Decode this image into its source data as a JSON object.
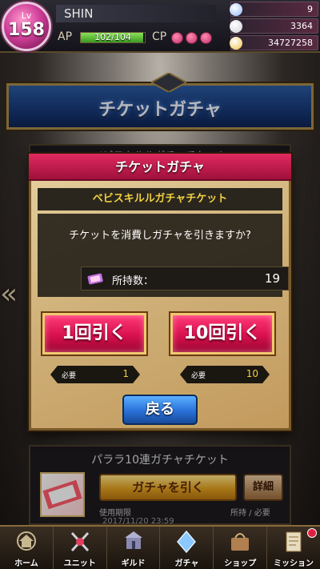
{
  "player": {
    "level_label": "Lv",
    "level": "158",
    "name": "SHIN",
    "ap_label": "AP",
    "ap_text": "102/104",
    "ap_fraction": 0.98,
    "cp_label": "CP",
    "cp_points": 3
  },
  "currencies": [
    {
      "icon": "crystal-icon",
      "value": "9",
      "color": "#8fb8ff"
    },
    {
      "icon": "silver-coin-icon",
      "value": "3364",
      "color": "#d0d0d8"
    },
    {
      "icon": "gold-coin-icon",
      "value": "34727258",
      "color": "#f0c040"
    }
  ],
  "banner": {
    "title": "チケットガチャ"
  },
  "bg_cards": {
    "card1_title": "ベビスキルルガチャチケット",
    "card2_title": "パララ10連ガチャチケット",
    "card2_draw": "ガチャを引く",
    "card2_detail": "詳細",
    "expiry_label": "使用期限",
    "expiry_value": "2017/11/20 23:59",
    "own_label": "所持 / 必要"
  },
  "dialog": {
    "title": "チケットガチャ",
    "ticket_name": "ベビスキルルガチャチケット",
    "question": "チケットを消費しガチャを引きますか?",
    "owned_label": "所持数：",
    "owned_value": "19",
    "draw_one": "1回引く",
    "draw_ten": "10回引く",
    "req_label": "必要",
    "req_one": "1",
    "req_ten": "10",
    "back": "戻る"
  },
  "nav": [
    {
      "label": "ホーム",
      "icon": "home-icon",
      "badge": false
    },
    {
      "label": "ユニット",
      "icon": "unit-icon",
      "badge": false
    },
    {
      "label": "ギルド",
      "icon": "guild-icon",
      "badge": false
    },
    {
      "label": "ガチャ",
      "icon": "gacha-icon",
      "badge": false
    },
    {
      "label": "ショップ",
      "icon": "shop-icon",
      "badge": false
    },
    {
      "label": "ミッション",
      "icon": "mission-icon",
      "badge": true
    }
  ]
}
